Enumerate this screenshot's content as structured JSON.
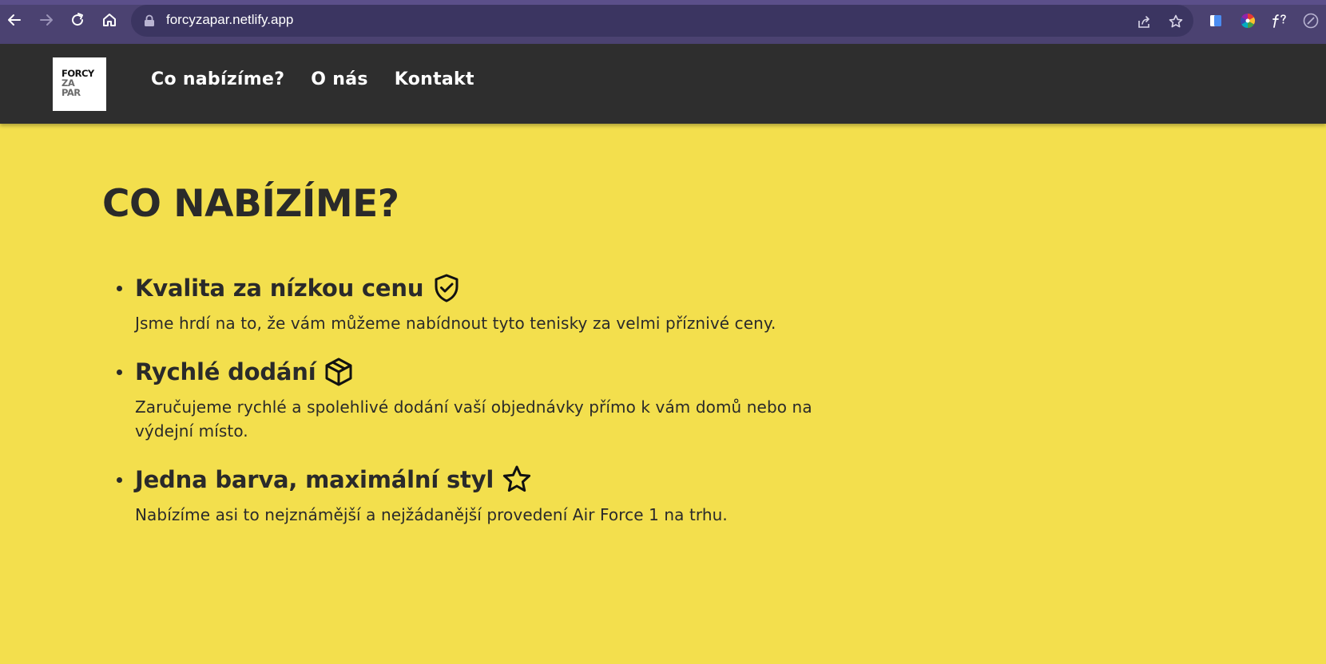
{
  "browser": {
    "url": "forcyzapar.netlify.app"
  },
  "site": {
    "logo": {
      "line1": "FORCY",
      "line2": "ZA",
      "line3": "PAR"
    },
    "menu": [
      {
        "label": "Co nabízíme?"
      },
      {
        "label": "O nás"
      },
      {
        "label": "Kontakt"
      }
    ]
  },
  "main": {
    "heading": "CO NABÍZÍME?",
    "features": [
      {
        "title": "Kvalita za nízkou cenu",
        "icon": "shield-check-icon",
        "desc": "Jsme hrdí na to, že vám můžeme nabídnout tyto tenisky za velmi příznivé ceny."
      },
      {
        "title": "Rychlé dodání",
        "icon": "package-icon",
        "desc": "Zaručujeme rychlé a spolehlivé dodání vaší objednávky přímo k vám domů nebo na výdejní místo."
      },
      {
        "title": "Jedna barva, maximální styl",
        "icon": "star-icon",
        "desc": "Nabízíme asi to nejznámější a nejžádanější provedení Air Force 1 na trhu."
      }
    ]
  },
  "colors": {
    "page_bg": "#f3df4d",
    "header_bg": "#2e2e2e",
    "text": "#2a2a2a",
    "chrome_bg": "#4b4271"
  }
}
